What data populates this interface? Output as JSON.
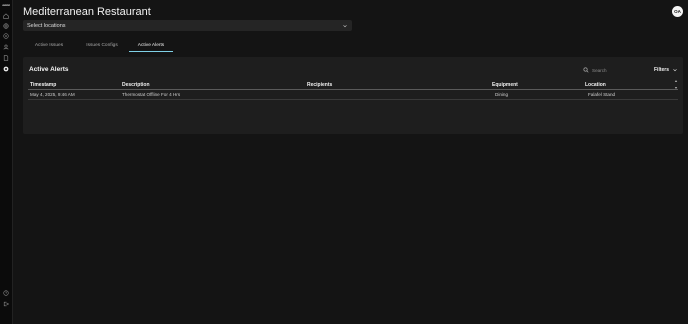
{
  "app": {
    "logo_text": "omni"
  },
  "header": {
    "title": "Mediterranean Restaurant",
    "avatar_initials": "OA"
  },
  "location_select": {
    "placeholder": "Select locations"
  },
  "tabs": [
    {
      "label": "Active Issues",
      "active": false
    },
    {
      "label": "Issues Configs",
      "active": false
    },
    {
      "label": "Active Alerts",
      "active": true
    }
  ],
  "alerts_card": {
    "title": "Active Alerts",
    "search_placeholder": "Search",
    "filters_label": "Filters",
    "columns": {
      "timestamp": "Timestamp",
      "description": "Description",
      "recipients": "Recipients",
      "equipment": "Equipment",
      "location": "Location"
    },
    "rows": [
      {
        "timestamp": "May 4, 2025, 9:46 AM",
        "description": "Thermostat Offline For 4 Hrs",
        "recipients": "",
        "equipment": "Dining",
        "location": "Falafel Stand"
      }
    ]
  },
  "sidebar": {
    "icons": [
      "home-icon",
      "globe-icon",
      "settings-icon",
      "user-icon",
      "document-icon",
      "alerts-icon"
    ],
    "active_icon": "alerts-icon",
    "bottom_icons": [
      "help-icon",
      "logout-icon"
    ]
  },
  "colors": {
    "accent": "#7fd0e6",
    "background": "#141414",
    "card": "#1e1e1e"
  }
}
